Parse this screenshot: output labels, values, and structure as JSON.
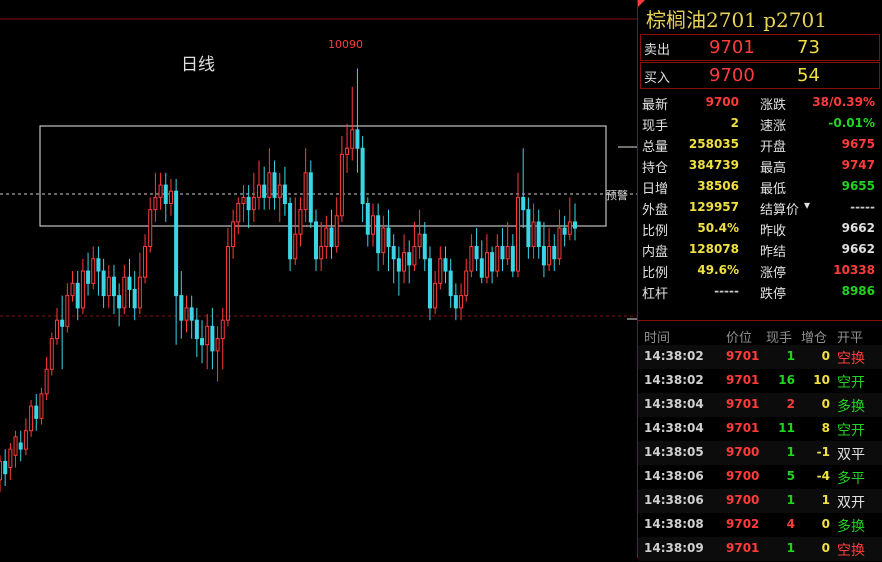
{
  "chart": {
    "period_label": "日线",
    "high_label": "10090",
    "alert_label": "预警",
    "price_range": [
      9550,
      10120
    ],
    "candles": [
      [
        9420,
        9450,
        9400,
        9460
      ],
      [
        9450,
        9430,
        9410,
        9470
      ],
      [
        9440,
        9470,
        9420,
        9480
      ],
      [
        9460,
        9490,
        9440,
        9500
      ],
      [
        9480,
        9470,
        9450,
        9500
      ],
      [
        9470,
        9500,
        9460,
        9520
      ],
      [
        9500,
        9540,
        9490,
        9550
      ],
      [
        9540,
        9520,
        9500,
        9560
      ],
      [
        9520,
        9560,
        9510,
        9570
      ],
      [
        9560,
        9600,
        9550,
        9620
      ],
      [
        9600,
        9650,
        9590,
        9660
      ],
      [
        9650,
        9680,
        9640,
        9700
      ],
      [
        9680,
        9670,
        9600,
        9720
      ],
      [
        9670,
        9720,
        9660,
        9740
      ],
      [
        9720,
        9740,
        9710,
        9760
      ],
      [
        9740,
        9700,
        9680,
        9760
      ],
      [
        9700,
        9760,
        9690,
        9780
      ],
      [
        9760,
        9740,
        9720,
        9790
      ],
      [
        9740,
        9780,
        9730,
        9800
      ],
      [
        9780,
        9760,
        9720,
        9800
      ],
      [
        9760,
        9720,
        9700,
        9780
      ],
      [
        9720,
        9750,
        9700,
        9770
      ],
      [
        9750,
        9720,
        9690,
        9770
      ],
      [
        9720,
        9700,
        9670,
        9740
      ],
      [
        9700,
        9750,
        9690,
        9770
      ],
      [
        9750,
        9730,
        9700,
        9780
      ],
      [
        9730,
        9700,
        9680,
        9760
      ],
      [
        9700,
        9750,
        9690,
        9790
      ],
      [
        9750,
        9800,
        9740,
        9820
      ],
      [
        9800,
        9860,
        9790,
        9880
      ],
      [
        9860,
        9880,
        9840,
        9920
      ],
      [
        9880,
        9900,
        9860,
        9920
      ],
      [
        9900,
        9870,
        9840,
        9920
      ],
      [
        9870,
        9890,
        9850,
        9910
      ],
      [
        9890,
        9720,
        9640,
        9910
      ],
      [
        9720,
        9680,
        9650,
        9760
      ],
      [
        9680,
        9700,
        9660,
        9720
      ],
      [
        9700,
        9680,
        9650,
        9720
      ],
      [
        9680,
        9650,
        9620,
        9700
      ],
      [
        9650,
        9640,
        9610,
        9680
      ],
      [
        9640,
        9670,
        9600,
        9690
      ],
      [
        9670,
        9630,
        9600,
        9700
      ],
      [
        9630,
        9650,
        9580,
        9670
      ],
      [
        9650,
        9680,
        9600,
        9700
      ],
      [
        9680,
        9800,
        9670,
        9830
      ],
      [
        9800,
        9840,
        9780,
        9860
      ],
      [
        9840,
        9870,
        9820,
        9880
      ],
      [
        9870,
        9880,
        9840,
        9900
      ],
      [
        9880,
        9860,
        9830,
        9900
      ],
      [
        9860,
        9880,
        9840,
        9920
      ],
      [
        9880,
        9900,
        9860,
        9940
      ],
      [
        9900,
        9880,
        9860,
        9930
      ],
      [
        9880,
        9920,
        9860,
        9960
      ],
      [
        9920,
        9880,
        9860,
        9940
      ],
      [
        9880,
        9900,
        9840,
        9920
      ],
      [
        9900,
        9870,
        9850,
        9930
      ],
      [
        9870,
        9780,
        9760,
        9880
      ],
      [
        9780,
        9820,
        9770,
        9880
      ],
      [
        9820,
        9860,
        9800,
        9880
      ],
      [
        9860,
        9920,
        9840,
        9960
      ],
      [
        9920,
        9840,
        9830,
        9940
      ],
      [
        9840,
        9780,
        9760,
        9860
      ],
      [
        9780,
        9800,
        9760,
        9840
      ],
      [
        9800,
        9830,
        9780,
        9850
      ],
      [
        9830,
        9800,
        9780,
        9860
      ],
      [
        9800,
        9850,
        9790,
        9880
      ],
      [
        9850,
        9950,
        9840,
        9980
      ],
      [
        9950,
        9960,
        9920,
        10000
      ],
      [
        9960,
        9990,
        9940,
        10060
      ],
      [
        9990,
        9960,
        9920,
        10090
      ],
      [
        9960,
        9870,
        9840,
        9980
      ],
      [
        9870,
        9820,
        9800,
        9880
      ],
      [
        9820,
        9850,
        9800,
        9870
      ],
      [
        9850,
        9790,
        9760,
        9870
      ],
      [
        9790,
        9830,
        9770,
        9850
      ],
      [
        9830,
        9800,
        9760,
        9860
      ],
      [
        9800,
        9780,
        9740,
        9820
      ],
      [
        9780,
        9760,
        9720,
        9800
      ],
      [
        9760,
        9790,
        9740,
        9820
      ],
      [
        9790,
        9770,
        9740,
        9810
      ],
      [
        9770,
        9800,
        9760,
        9840
      ],
      [
        9800,
        9820,
        9780,
        9860
      ],
      [
        9820,
        9780,
        9760,
        9840
      ],
      [
        9780,
        9700,
        9680,
        9800
      ],
      [
        9700,
        9740,
        9690,
        9760
      ],
      [
        9740,
        9780,
        9730,
        9800
      ],
      [
        9780,
        9760,
        9740,
        9800
      ],
      [
        9760,
        9720,
        9700,
        9780
      ],
      [
        9720,
        9700,
        9680,
        9740
      ],
      [
        9700,
        9720,
        9680,
        9740
      ],
      [
        9720,
        9760,
        9710,
        9780
      ],
      [
        9760,
        9800,
        9750,
        9820
      ],
      [
        9800,
        9780,
        9760,
        9830
      ],
      [
        9780,
        9750,
        9740,
        9810
      ],
      [
        9750,
        9790,
        9740,
        9820
      ],
      [
        9790,
        9760,
        9740,
        9800
      ],
      [
        9760,
        9800,
        9750,
        9820
      ],
      [
        9800,
        9780,
        9760,
        9830
      ],
      [
        9780,
        9800,
        9770,
        9840
      ],
      [
        9800,
        9760,
        9750,
        9820
      ],
      [
        9760,
        9880,
        9750,
        9920
      ],
      [
        9880,
        9860,
        9830,
        9960
      ],
      [
        9860,
        9800,
        9780,
        9880
      ],
      [
        9800,
        9840,
        9780,
        9870
      ],
      [
        9840,
        9800,
        9780,
        9860
      ],
      [
        9800,
        9770,
        9750,
        9840
      ],
      [
        9770,
        9800,
        9760,
        9830
      ],
      [
        9800,
        9780,
        9760,
        9820
      ],
      [
        9780,
        9830,
        9770,
        9860
      ],
      [
        9830,
        9820,
        9800,
        9850
      ],
      [
        9820,
        9840,
        9810,
        9880
      ],
      [
        9840,
        9830,
        9810,
        9870
      ]
    ]
  },
  "panel": {
    "title": "棕榈油2701  p2701",
    "sell": {
      "label": "卖出",
      "price": "9701",
      "vol": "73"
    },
    "buy": {
      "label": "买入",
      "price": "9700",
      "vol": "54"
    },
    "stats": [
      {
        "l": "最新",
        "v": "9700",
        "c": "#ff3b3b",
        "l2": "涨跌",
        "v2": "38/0.39%",
        "c2": "#ff3b3b"
      },
      {
        "l": "现手",
        "v": "2",
        "c": "#f0e040",
        "l2": "速涨",
        "v2": "-0.01%",
        "c2": "#22d322"
      },
      {
        "l": "总量",
        "v": "258035",
        "c": "#f0e040",
        "l2": "开盘",
        "v2": "9675",
        "c2": "#ff3b3b"
      },
      {
        "l": "持仓",
        "v": "384739",
        "c": "#f0e040",
        "l2": "最高",
        "v2": "9747",
        "c2": "#ff3b3b"
      },
      {
        "l": "日增",
        "v": "38506",
        "c": "#f0e040",
        "l2": "最低",
        "v2": "9655",
        "c2": "#22d322"
      },
      {
        "l": "外盘",
        "v": "129957",
        "c": "#f0e040",
        "l2": "结算价",
        "v2": "-----",
        "c2": "#c8c8c8"
      },
      {
        "l": "比例",
        "v": "50.4%",
        "c": "#f0e040",
        "l2": "昨收",
        "v2": "9662",
        "c2": "#e0e0e0"
      },
      {
        "l": "内盘",
        "v": "128078",
        "c": "#f0e040",
        "l2": "昨结",
        "v2": "9662",
        "c2": "#e0e0e0"
      },
      {
        "l": "比例",
        "v": "49.6%",
        "c": "#f0e040",
        "l2": "涨停",
        "v2": "10338",
        "c2": "#ff3b3b"
      },
      {
        "l": "杠杆",
        "v": "-----",
        "c": "#c8c8c8",
        "l2": "跌停",
        "v2": "8986",
        "c2": "#22d322"
      }
    ],
    "tick_headers": {
      "time": "时间",
      "price": "价位",
      "hand": "现手",
      "oi": "增仓",
      "type": "开平"
    },
    "ticks": [
      {
        "t": "14:38:02",
        "p": "9701",
        "h": "1",
        "hc": "#22d322",
        "oi": "0",
        "oc": "#f0e040",
        "ty": "空换",
        "tc": "#ff3b3b"
      },
      {
        "t": "14:38:02",
        "p": "9701",
        "h": "16",
        "hc": "#22d322",
        "oi": "10",
        "oc": "#f0e040",
        "ty": "空开",
        "tc": "#22d322"
      },
      {
        "t": "14:38:04",
        "p": "9701",
        "h": "2",
        "hc": "#ff3b3b",
        "oi": "0",
        "oc": "#f0e040",
        "ty": "多换",
        "tc": "#22d322"
      },
      {
        "t": "14:38:04",
        "p": "9701",
        "h": "11",
        "hc": "#22d322",
        "oi": "8",
        "oc": "#f0e040",
        "ty": "空开",
        "tc": "#22d322"
      },
      {
        "t": "14:38:05",
        "p": "9700",
        "h": "1",
        "hc": "#22d322",
        "oi": "-1",
        "oc": "#f0e040",
        "ty": "双平",
        "tc": "#e0e0e0"
      },
      {
        "t": "14:38:06",
        "p": "9700",
        "h": "5",
        "hc": "#22d322",
        "oi": "-4",
        "oc": "#f0e040",
        "ty": "多平",
        "tc": "#22d322"
      },
      {
        "t": "14:38:06",
        "p": "9700",
        "h": "1",
        "hc": "#22d322",
        "oi": "1",
        "oc": "#f0e040",
        "ty": "双开",
        "tc": "#e0e0e0"
      },
      {
        "t": "14:38:08",
        "p": "9702",
        "h": "4",
        "hc": "#ff3b3b",
        "oi": "0",
        "oc": "#f0e040",
        "ty": "多换",
        "tc": "#22d322"
      },
      {
        "t": "14:38:09",
        "p": "9701",
        "h": "1",
        "hc": "#22d322",
        "oi": "0",
        "oc": "#f0e040",
        "ty": "空换",
        "tc": "#ff3b3b"
      }
    ]
  }
}
